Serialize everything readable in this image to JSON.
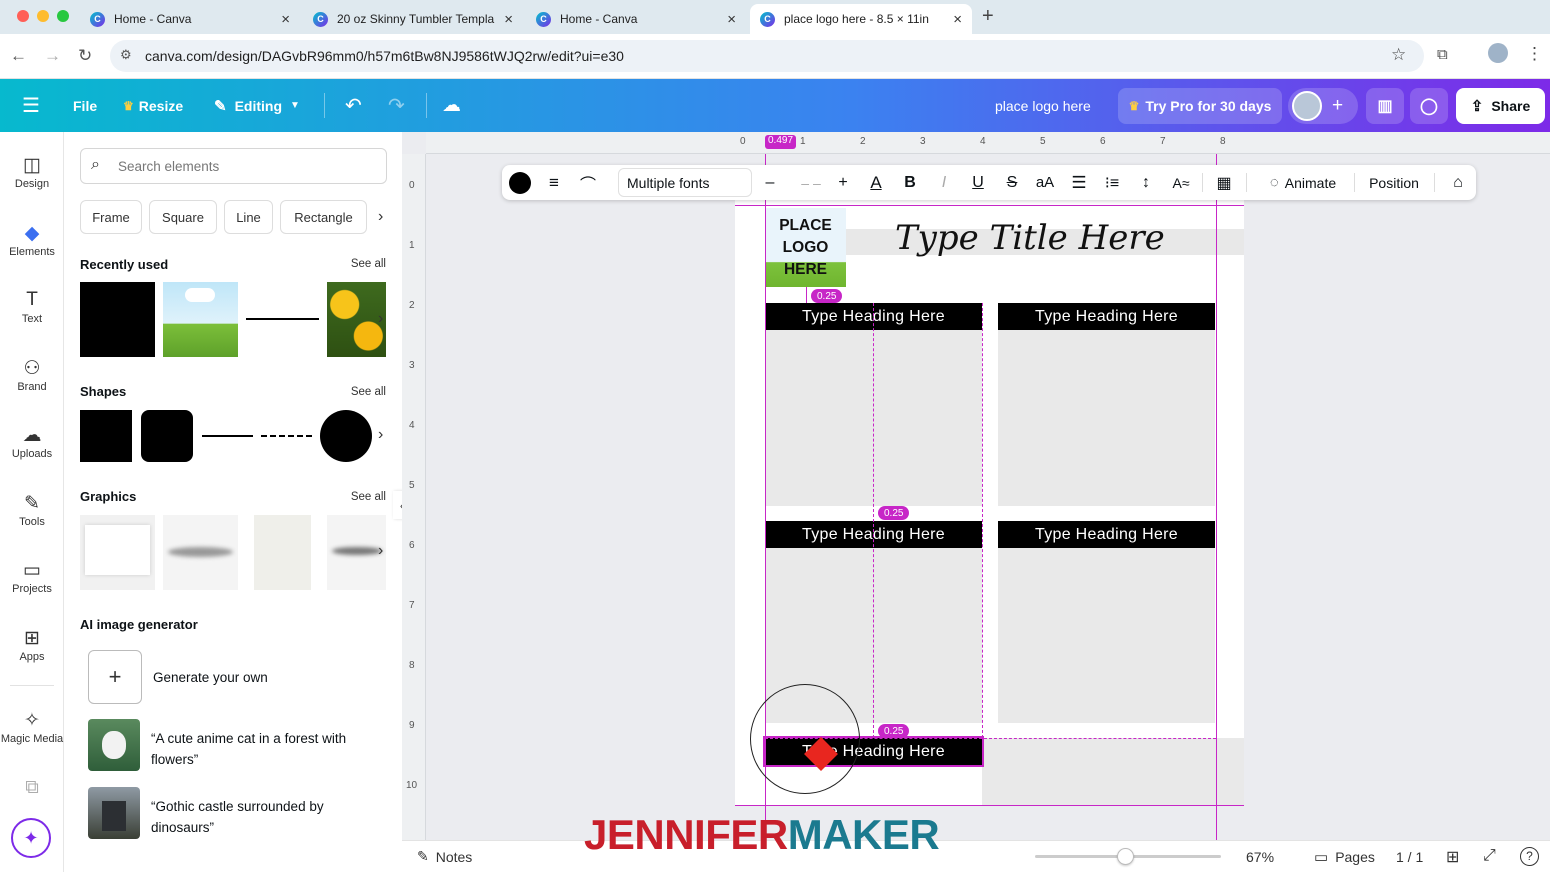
{
  "browser": {
    "tabs": [
      {
        "title": "Home - Canva"
      },
      {
        "title": "20 oz Skinny Tumbler Templa"
      },
      {
        "title": "Home - Canva"
      },
      {
        "title": "place logo here - 8.5 × 11in"
      }
    ],
    "url": "canva.com/design/DAGvbR96mm0/h57m6tBw8NJ9586tWJQ2rw/edit?ui=e30"
  },
  "header": {
    "file": "File",
    "resize": "Resize",
    "editing": "Editing",
    "doc_title": "place logo here",
    "try_pro": "Try Pro for 30 days",
    "share": "Share"
  },
  "rail": {
    "design": "Design",
    "elements": "Elements",
    "text": "Text",
    "brand": "Brand",
    "uploads": "Uploads",
    "tools": "Tools",
    "projects": "Projects",
    "apps": "Apps",
    "magic_media": "Magic Media"
  },
  "panel": {
    "search_placeholder": "Search elements",
    "chips": [
      "Frame",
      "Square",
      "Line",
      "Rectangle"
    ],
    "recently_used": "Recently used",
    "shapes": "Shapes",
    "graphics": "Graphics",
    "see_all": "See all",
    "ai_title": "AI image generator",
    "generate": "Generate your own",
    "prompt1": "“A cute anime cat in a forest with flowers”",
    "prompt2": "“Gothic castle surrounded by dinosaurs”"
  },
  "toolbar": {
    "font": "Multiple fonts",
    "font_size": "– –",
    "case": "aA",
    "animate": "Animate",
    "position": "Position"
  },
  "ruler": {
    "top": [
      "0",
      "1",
      "2",
      "3",
      "4",
      "5",
      "6",
      "7",
      "8"
    ],
    "left": [
      "0",
      "1",
      "2",
      "3",
      "4",
      "5",
      "6",
      "7",
      "8",
      "9",
      "10"
    ],
    "marker": "0.497"
  },
  "canvas": {
    "logo": "PLACE LOGO HERE",
    "title": "Type Title Here",
    "heading": "Type Heading Here",
    "spacing": "0.25"
  },
  "bottom": {
    "notes": "Notes",
    "zoom": "67%",
    "pages": "Pages",
    "page_count": "1 / 1"
  },
  "watermark": "JENNIFERMAKER",
  "colors": {
    "accent": "#c726c7",
    "brand_teal": "#07b9ce",
    "brand_purple": "#7d2ae8"
  }
}
